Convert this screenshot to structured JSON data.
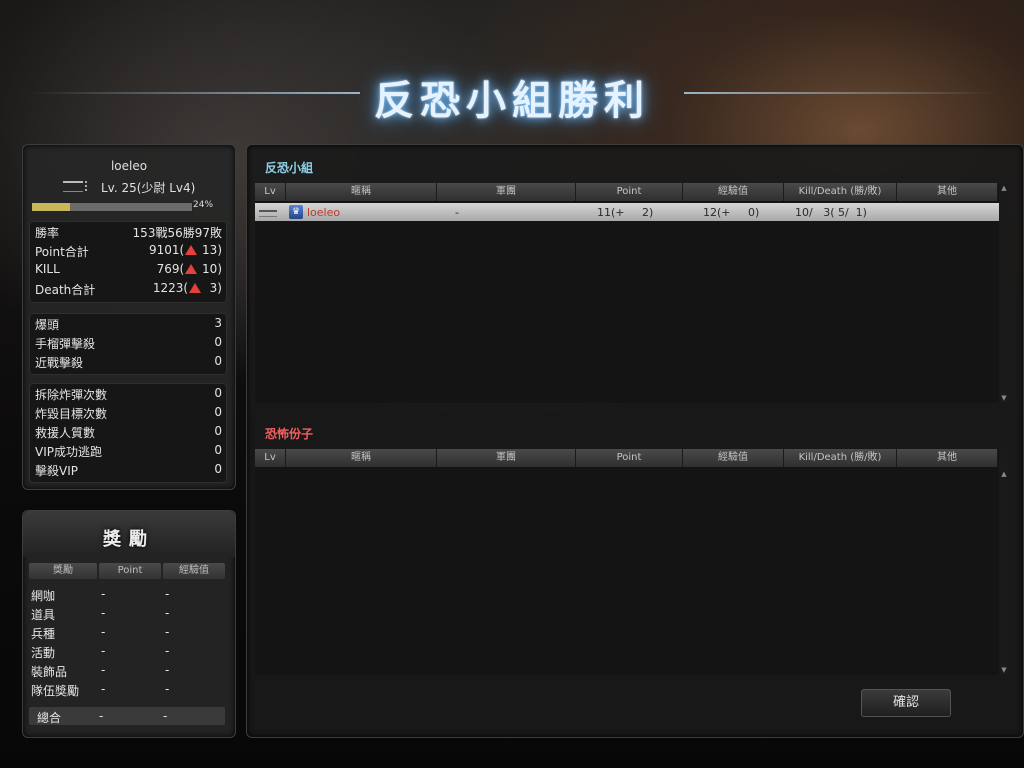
{
  "title": "反恐小組勝利",
  "player": {
    "name": "loeleo",
    "level": "Lv. 25(少尉 Lv4)",
    "xp_percent": 24,
    "xp_label": "24%"
  },
  "stats_main": [
    {
      "label": "勝率",
      "value": "153戰56勝97敗",
      "up": false,
      "delta": ""
    },
    {
      "label": "Point合計",
      "value": "9101(",
      "up": true,
      "delta": " 13)"
    },
    {
      "label": "KILL",
      "value": "769(",
      "up": true,
      "delta": " 10)"
    },
    {
      "label": "Death合計",
      "value": "1223(",
      "up": true,
      "delta": "  3)"
    }
  ],
  "stats_combat": [
    {
      "label": "爆頭",
      "value": "3"
    },
    {
      "label": "手榴彈擊殺",
      "value": "0"
    },
    {
      "label": "近戰擊殺",
      "value": "0"
    }
  ],
  "stats_mission": [
    {
      "label": "拆除炸彈次數",
      "value": "0"
    },
    {
      "label": "炸毀目標次數",
      "value": "0"
    },
    {
      "label": "救援人質數",
      "value": "0"
    },
    {
      "label": "VIP成功逃跑",
      "value": "0"
    },
    {
      "label": "擊殺VIP",
      "value": "0"
    }
  ],
  "rewards": {
    "title": "獎勵",
    "headers": [
      "獎勵",
      "Point",
      "經驗值"
    ],
    "rows": [
      {
        "name": "網咖",
        "point": "-",
        "exp": "-"
      },
      {
        "name": "道具",
        "point": "-",
        "exp": "-"
      },
      {
        "name": "兵種",
        "point": "-",
        "exp": "-"
      },
      {
        "name": "活動",
        "point": "-",
        "exp": "-"
      },
      {
        "name": "裝飾品",
        "point": "-",
        "exp": "-"
      },
      {
        "name": "隊伍獎勵",
        "point": "-",
        "exp": "-"
      }
    ],
    "total": {
      "name": "總合",
      "point": "-",
      "exp": "-"
    }
  },
  "columns": [
    "Lv",
    "暱稱",
    "軍團",
    "Point",
    "經驗值",
    "Kill/Death (勝/敗)",
    "其他"
  ],
  "ct_team": {
    "label": "反恐小組",
    "color": "#8fd0e8",
    "rows": [
      {
        "name": "loeleo",
        "clan": "-",
        "point": "11(+     2)",
        "exp": "12(+     0)",
        "kd": "10/   3( 5/  1)",
        "other": ""
      }
    ]
  },
  "t_team": {
    "label": "恐怖份子",
    "color": "#f06060",
    "rows": []
  },
  "confirm_label": "確認",
  "colors": {
    "title_glow": "#7ec4ff",
    "player_name_in_table": "#c0392b",
    "xp_fill": "#c9b55a",
    "delta_arrow": "#e4413d"
  }
}
